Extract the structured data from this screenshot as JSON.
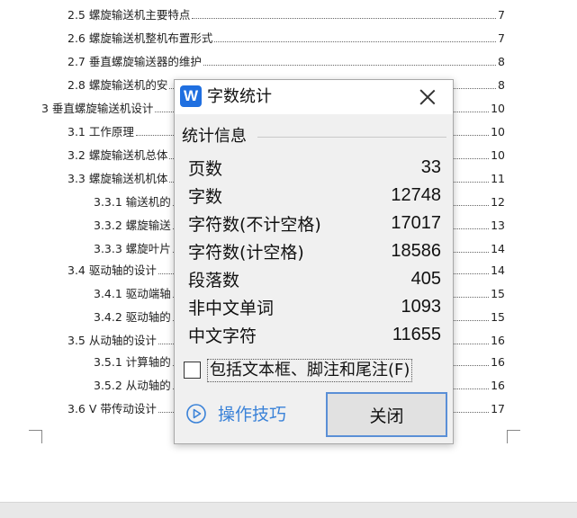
{
  "document": {
    "toc": [
      {
        "text": "2.5 螺旋输送机主要特点",
        "page": "7"
      },
      {
        "text": "2.6 螺旋输送机整机布置形式",
        "page": "7"
      },
      {
        "text": "2.7 垂直螺旋输送器的维护",
        "page": "8"
      },
      {
        "text": "2.8 螺旋输送机的安",
        "page": "8"
      },
      {
        "text": "3 垂直螺旋输送机设计",
        "page": "10"
      },
      {
        "text": "3.1 工作原理",
        "page": "10"
      },
      {
        "text": "3.2 螺旋输送机总体",
        "page": "10"
      },
      {
        "text": "3.3 螺旋输送机机体",
        "page": "11"
      },
      {
        "text": "3.3.1 输送机的",
        "page": "12"
      },
      {
        "text": "3.3.2 螺旋输送",
        "page": "13"
      },
      {
        "text": "3.3.3 螺旋叶片",
        "page": "14"
      },
      {
        "text": "3.4 驱动轴的设计",
        "page": "14"
      },
      {
        "text": "3.4.1 驱动端轴",
        "page": "15"
      },
      {
        "text": "3.4.2 驱动轴的",
        "page": "15"
      },
      {
        "text": "3.5 从动轴的设计",
        "page": "16"
      },
      {
        "text": "3.5.1 计算轴的",
        "page": "16"
      },
      {
        "text": "3.5.2 从动轴的",
        "page": "16"
      },
      {
        "text": "3.6 V 带传动设计",
        "page": "17"
      }
    ]
  },
  "dialog": {
    "app_icon": "W",
    "title": "字数统计",
    "close_icon": "close-icon",
    "group_title": "统计信息",
    "stats": [
      {
        "label": "页数",
        "value": "33"
      },
      {
        "label": "字数",
        "value": "12748"
      },
      {
        "label": "字符数(不计空格)",
        "value": "17017"
      },
      {
        "label": "字符数(计空格)",
        "value": "18586"
      },
      {
        "label": "段落数",
        "value": "405"
      },
      {
        "label": "非中文单词",
        "value": "1093"
      },
      {
        "label": "中文字符",
        "value": "11655"
      }
    ],
    "checkbox_label": "包括文本框、脚注和尾注(F)",
    "checkbox_checked": false,
    "tips_label": "操作技巧",
    "close_button": "关闭"
  },
  "colors": {
    "accent": "#1f6fe0",
    "link": "#3a82d8",
    "button_border": "#5a8fd6"
  }
}
